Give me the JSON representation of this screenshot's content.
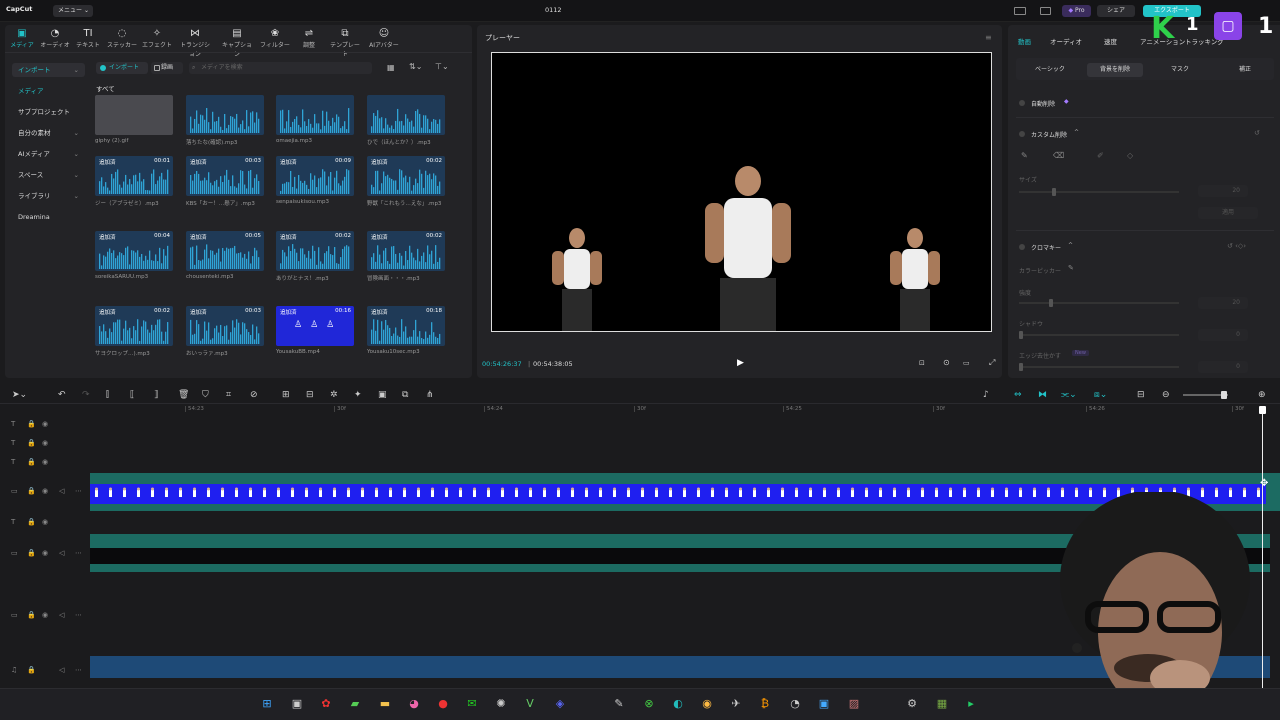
{
  "app": {
    "logo": "CapCut",
    "menu_label": "メニュー",
    "project_title": "0112"
  },
  "titlebar_right": {
    "pro_label": "Pro",
    "share_label": "シェア",
    "export_label": "エクスポート"
  },
  "tools": [
    {
      "label": "メディア",
      "icon": "media-icon"
    },
    {
      "label": "オーディオ",
      "icon": "audio-icon"
    },
    {
      "label": "テキスト",
      "icon": "text-icon"
    },
    {
      "label": "ステッカー",
      "icon": "sticker-icon"
    },
    {
      "label": "エフェクト",
      "icon": "effect-icon"
    },
    {
      "label": "トランジション",
      "icon": "transition-icon"
    },
    {
      "label": "キャプション",
      "icon": "caption-icon"
    },
    {
      "label": "フィルター",
      "icon": "filter-icon"
    },
    {
      "label": "調整",
      "icon": "adjust-icon"
    },
    {
      "label": "テンプレート",
      "icon": "template-icon"
    },
    {
      "label": "AIアバター",
      "icon": "ai-avatar-icon"
    }
  ],
  "sidebar": [
    {
      "label": "インポート",
      "caret": "⌄"
    },
    {
      "label": "メディア",
      "caret": ""
    },
    {
      "label": "サブプロジェクト",
      "caret": ""
    },
    {
      "label": "自分の素材",
      "caret": "⌄"
    },
    {
      "label": "AIメディア",
      "caret": "⌄"
    },
    {
      "label": "スペース",
      "caret": "⌄"
    },
    {
      "label": "ライブラリ",
      "caret": "⌄"
    },
    {
      "label": "Dreamina",
      "caret": ""
    }
  ],
  "media_toolbar": {
    "import_label": "インポート",
    "record_label": "録画",
    "search_placeholder": "メディアを検索",
    "section_all": "すべて"
  },
  "media_items": [
    {
      "name": "giphy (2).gif",
      "tag": "",
      "dur": "",
      "kind": "gray"
    },
    {
      "name": "落ちたな(確認).mp3",
      "tag": "",
      "dur": "",
      "kind": "audio"
    },
    {
      "name": "omaejia.mp3",
      "tag": "",
      "dur": "",
      "kind": "audio"
    },
    {
      "name": "ひで（ほんとか？）.mp3",
      "tag": "",
      "dur": "",
      "kind": "audio"
    },
    {
      "name": "ジー（アブラゼミ）.mp3",
      "tag": "追加済",
      "dur": "00:01",
      "kind": "audio"
    },
    {
      "name": "KBS「おー！…懸ア」.mp3",
      "tag": "追加済",
      "dur": "00:03",
      "kind": "audio"
    },
    {
      "name": "senpaisukisou.mp3",
      "tag": "追加済",
      "dur": "00:09",
      "kind": "audio"
    },
    {
      "name": "野獣「これもう…えな」.mp3",
      "tag": "追加済",
      "dur": "00:02",
      "kind": "audio"
    },
    {
      "name": "soreikaSARUU.mp3",
      "tag": "追加済",
      "dur": "00:04",
      "kind": "audio"
    },
    {
      "name": "chousenteki.mp3",
      "tag": "追加済",
      "dur": "00:05",
      "kind": "audio"
    },
    {
      "name": "ありがとナス！.mp3",
      "tag": "追加済",
      "dur": "00:02",
      "kind": "audio"
    },
    {
      "name": "冒険画面・・・.mp3",
      "tag": "追加済",
      "dur": "00:02",
      "kind": "audio"
    },
    {
      "name": "サヨクロップ…).mp3",
      "tag": "追加済",
      "dur": "00:02",
      "kind": "audio"
    },
    {
      "name": "おいっラァ.mp3",
      "tag": "追加済",
      "dur": "00:03",
      "kind": "audio"
    },
    {
      "name": "YousakuBB.mp4",
      "tag": "追加済",
      "dur": "00:16",
      "kind": "video"
    },
    {
      "name": "Yousaku10sec.mp3",
      "tag": "追加済",
      "dur": "00:18",
      "kind": "audio"
    }
  ],
  "player": {
    "title": "プレーヤー",
    "current_time": "00:54:26:37",
    "total_time": "00:54:38:05"
  },
  "inspector": {
    "tabs": [
      "動画",
      "オーディオ",
      "速度",
      "アニメーション",
      "トラッキング"
    ],
    "subtabs": [
      "ベーシック",
      "背景を削除",
      "マスク",
      "補正"
    ],
    "auto_remove": "自動削除",
    "custom_remove": "カスタム削除",
    "size_label": "サイズ",
    "size_value": "20",
    "apply_label": "適用",
    "chroma_key": "クロマキー",
    "color_picker": "カラーピッカー",
    "strength_label": "強度",
    "strength_value": "20",
    "shadow_label": "シャドウ",
    "shadow_value": "0",
    "edge_label": "エッジ去住かす",
    "edge_value": "0",
    "new_badge": "New"
  },
  "timeline": {
    "ruler": [
      "54:23",
      "30f",
      "54:24",
      "30f",
      "54:25",
      "30f",
      "54:26",
      "30f"
    ]
  },
  "overlay": {
    "letter": "K",
    "num": "1",
    "big_num": "1"
  },
  "colors": {
    "accent": "#22c3c8",
    "video_clip": "#1f1ff0",
    "track_teal": "#1c6b62",
    "audio_blue": "#1f3a57"
  }
}
